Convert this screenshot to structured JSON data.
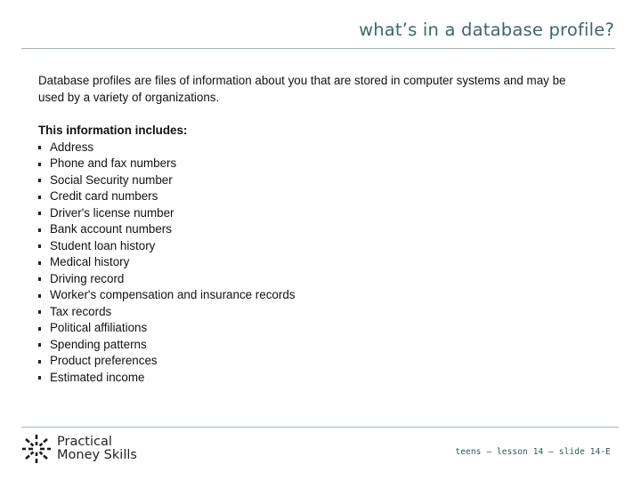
{
  "header": {
    "title": "what’s in a database profile?"
  },
  "intro": {
    "text": "Database profiles are files of information about you that are stored in computer systems and may be used by a variety of organizations."
  },
  "includes": {
    "heading": "This information includes:",
    "items": [
      "Address",
      "Phone and fax numbers",
      "Social Security number",
      "Credit card numbers",
      "Driver's license number",
      "Bank account numbers",
      "Student loan history",
      "Medical history",
      "Driving record",
      "Worker's compensation and insurance records",
      "Tax records",
      "Political affiliations",
      "Spending patterns",
      "Product preferences",
      "Estimated income"
    ]
  },
  "footer": {
    "logo_icon": "starburst-icon",
    "logo_line1": "Practical",
    "logo_line2": "Money Skills",
    "slide_ref": "teens – lesson 14 – slide 14-E"
  },
  "colors": {
    "title": "#3b6868",
    "rule": "#9fb5b5",
    "footer_ref": "#2f5757"
  }
}
